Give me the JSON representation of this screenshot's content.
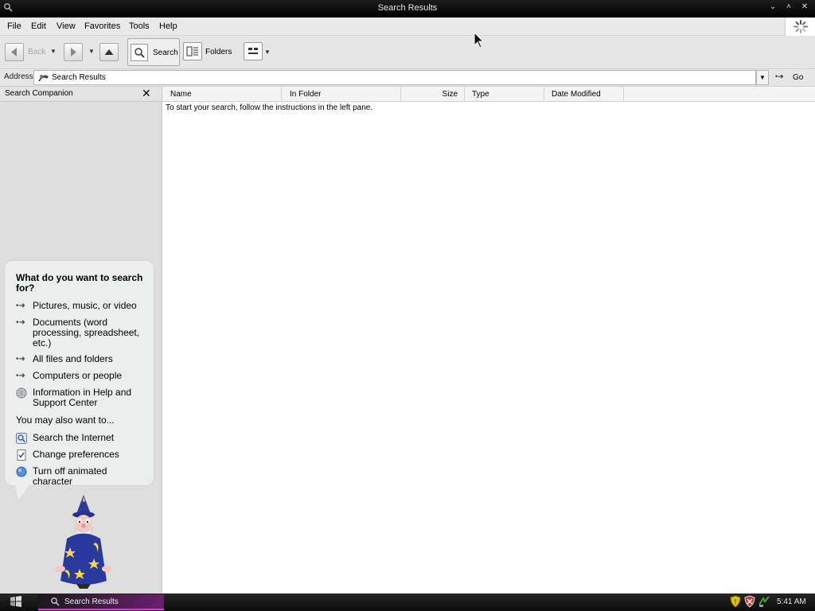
{
  "window": {
    "title": "Search Results",
    "minimize_glyph": "⌄",
    "maximize_glyph": "˄",
    "close_glyph": "✕"
  },
  "menu": [
    "File",
    "Edit",
    "View",
    "Favorites",
    "Tools",
    "Help"
  ],
  "toolbar": {
    "back_label": "Back",
    "search_label": "Search",
    "folders_label": "Folders"
  },
  "address": {
    "label": "Address",
    "value": "Search Results",
    "go_label": "Go"
  },
  "search_companion": {
    "header": "Search Companion",
    "question": "What do you want to search for?",
    "options": [
      {
        "icon": "arrow-icon",
        "label": "Pictures, music, or video"
      },
      {
        "icon": "arrow-icon",
        "label": "Documents (word processing, spreadsheet, etc.)"
      },
      {
        "icon": "arrow-icon",
        "label": "All files and folders"
      },
      {
        "icon": "arrow-icon",
        "label": "Computers or people"
      },
      {
        "icon": "help-globe-icon",
        "label": "Information in Help and Support Center"
      }
    ],
    "also_header": "You may also want to...",
    "also_options": [
      {
        "icon": "search-internet-icon",
        "label": "Search the Internet"
      },
      {
        "icon": "preferences-icon",
        "label": "Change preferences"
      },
      {
        "icon": "animated-character-icon",
        "label": "Turn off animated character"
      }
    ]
  },
  "results": {
    "columns": [
      "Name",
      "In Folder",
      "Size",
      "Type",
      "Date Modified"
    ],
    "empty_message": "To start your search, follow the instructions in the left pane."
  },
  "taskbar": {
    "task_label": "Search Results",
    "clock": "5:41 AM"
  },
  "colors": {
    "titlebar": "#000000",
    "taskbar_accent": "#d43ec8",
    "pane_bg": "#dedede",
    "bubble_bg": "#eceeee"
  }
}
